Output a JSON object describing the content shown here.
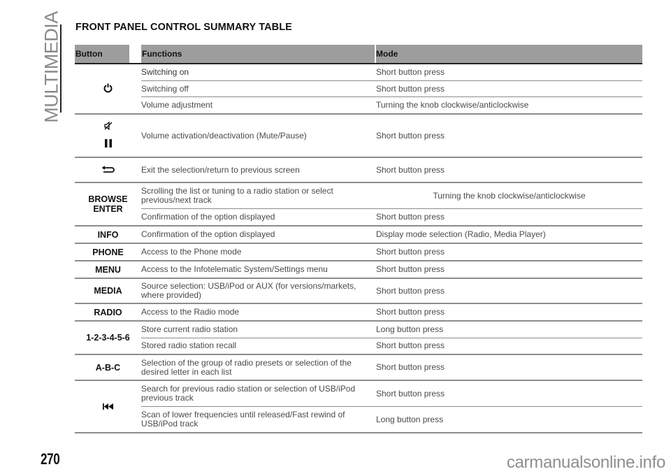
{
  "section_label": "MULTIMEDIA",
  "title": "FRONT PANEL CONTROL SUMMARY TABLE",
  "table": {
    "headers": {
      "button": "Button",
      "functions": "Functions",
      "mode": "Mode"
    },
    "groups": [
      {
        "button_icon": "power-icon",
        "rows": [
          {
            "function": "Switching on",
            "mode": "Short button press"
          },
          {
            "function": "Switching off",
            "mode": "Short button press"
          },
          {
            "function": "Volume adjustment",
            "mode": "Turning the knob clockwise/anticlockwise"
          }
        ]
      },
      {
        "button_icons": [
          "mute-icon",
          "pause-icon"
        ],
        "rows": [
          {
            "function": "Volume activation/deactivation (Mute/Pause)",
            "mode": "Short button press"
          }
        ]
      },
      {
        "button_icon": "back-arrow-icon",
        "rows": [
          {
            "function": "Exit the selection/return to previous screen",
            "mode": "Short button press"
          }
        ]
      },
      {
        "button_label": "BROWSE ENTER",
        "button_label_lines": [
          "BROWSE",
          "ENTER"
        ],
        "rows": [
          {
            "function": "Scrolling the list or tuning to a radio station or select previous/next track",
            "mode": "Turning the knob clockwise/anticlockwise"
          },
          {
            "function": "Confirmation of the option displayed",
            "mode": "Short button press"
          }
        ]
      },
      {
        "button_label": "INFO",
        "rows": [
          {
            "function": "Confirmation of the option displayed",
            "mode": "Display mode selection (Radio, Media Player)"
          }
        ]
      },
      {
        "button_label": "PHONE",
        "rows": [
          {
            "function": "Access to the Phone mode",
            "mode": "Short button press"
          }
        ]
      },
      {
        "button_label": "MENU",
        "rows": [
          {
            "function": "Access to the Infotelematic System/Settings menu",
            "mode": "Short button press"
          }
        ]
      },
      {
        "button_label": "MEDIA",
        "rows": [
          {
            "function": "Source selection: USB/iPod or AUX (for versions/markets, where provided)",
            "mode": "Short button press"
          }
        ]
      },
      {
        "button_label": "RADIO",
        "rows": [
          {
            "function": "Access to the Radio mode",
            "mode": "Short button press"
          }
        ]
      },
      {
        "button_label": "1-2-3-4-5-6",
        "rows": [
          {
            "function": "Store current radio station",
            "mode": "Long button press"
          },
          {
            "function": "Stored radio station recall",
            "mode": "Short button press"
          }
        ]
      },
      {
        "button_label": "A-B-C",
        "rows": [
          {
            "function": "Selection of the group of radio presets or selection of the desired letter in each list",
            "mode": "Short button press"
          }
        ]
      },
      {
        "button_icon": "skip-previous-icon",
        "rows": [
          {
            "function": "Search for previous radio station or selection of USB/iPod previous track",
            "mode": "Short button press"
          },
          {
            "function": "Scan of lower frequencies until released/Fast rewind of USB/iPod track",
            "mode": "Long button press"
          }
        ]
      }
    ]
  },
  "page_number": "270",
  "watermark": "carmanualsonline.info"
}
